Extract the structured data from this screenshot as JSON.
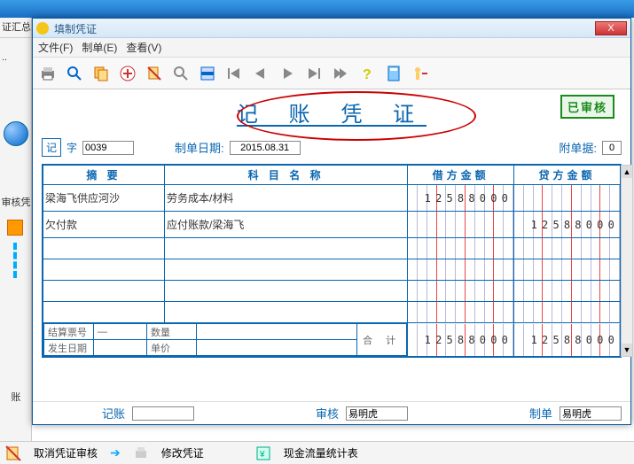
{
  "window": {
    "title": "填制凭证",
    "close": "X"
  },
  "menu": {
    "file": "文件(F)",
    "make": "制单(E)",
    "view": "查看(V)"
  },
  "toolbar_icons": [
    "print-icon",
    "preview-icon",
    "copy-icon",
    "add-icon",
    "delete-icon",
    "find-icon",
    "insert-icon",
    "first-icon",
    "prev-icon",
    "next-icon",
    "last-icon",
    "end-icon",
    "help-icon",
    "calc-icon",
    "exit-icon"
  ],
  "voucher": {
    "title": "记 账 凭 证",
    "stamp": "已审核",
    "type_label": "记",
    "type_char": "字",
    "number": "0039",
    "date_label": "制单日期:",
    "date_value": "2015.08.31",
    "attach_label": "附单据:",
    "attach_value": "0"
  },
  "table": {
    "headers": {
      "summary": "摘  要",
      "subject": "科 目 名 称",
      "debit": "借方金额",
      "credit": "贷方金额"
    },
    "rows": [
      {
        "summary": "梁海飞供应河沙",
        "subject": "劳务成本/材料",
        "debit": "12588000",
        "credit": ""
      },
      {
        "summary": "欠付款",
        "subject": "应付账款/梁海飞",
        "debit": "",
        "credit": "12588000"
      }
    ],
    "footer": {
      "ticket_label": "结算票号",
      "ticket_value": "—",
      "qty_label": "数量",
      "date_label": "发生日期",
      "price_label": "单价",
      "total_label": "合  计",
      "total_debit": "12588000",
      "total_credit": "12588000"
    }
  },
  "footer": {
    "post_label": "记账",
    "audit_label": "审核",
    "audit_value": "易明虎",
    "maker_label": "制单",
    "maker_value": "易明虎"
  },
  "bottom_actions": {
    "cancel_audit": "取消凭证审核",
    "modify": "修改凭证",
    "cashflow": "现金流量统计表"
  },
  "left_panel": {
    "top": "证汇总",
    "mid": "审核凭",
    "bottom": "账"
  }
}
